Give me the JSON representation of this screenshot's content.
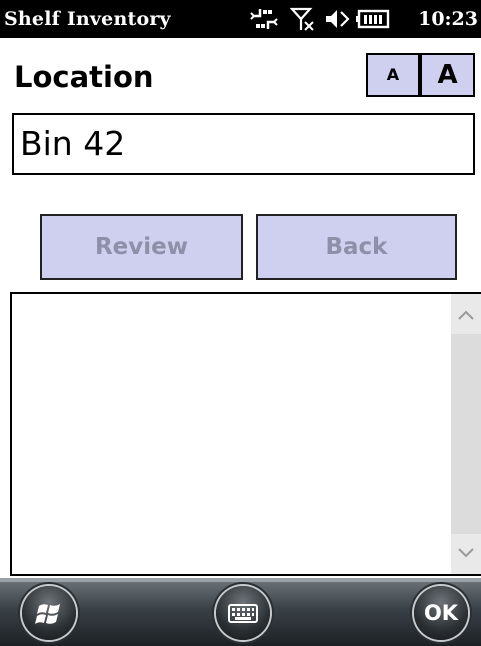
{
  "status_bar": {
    "app_title": "Shelf Inventory",
    "time": "10:23",
    "icons": [
      "sync-icon",
      "no-signal-icon",
      "speaker-muted-icon",
      "battery-icon"
    ]
  },
  "form": {
    "location_label": "Location",
    "font_small_label": "A",
    "font_large_label": "A",
    "location_value": "Bin 42"
  },
  "actions": {
    "review_label": "Review",
    "back_label": "Back"
  },
  "results": {
    "items": []
  },
  "softkeys": {
    "ok_label": "OK"
  },
  "colors": {
    "button_fill": "#cfd0ef",
    "disabled_text": "#8e8fa8",
    "status_bar": "#000000"
  }
}
